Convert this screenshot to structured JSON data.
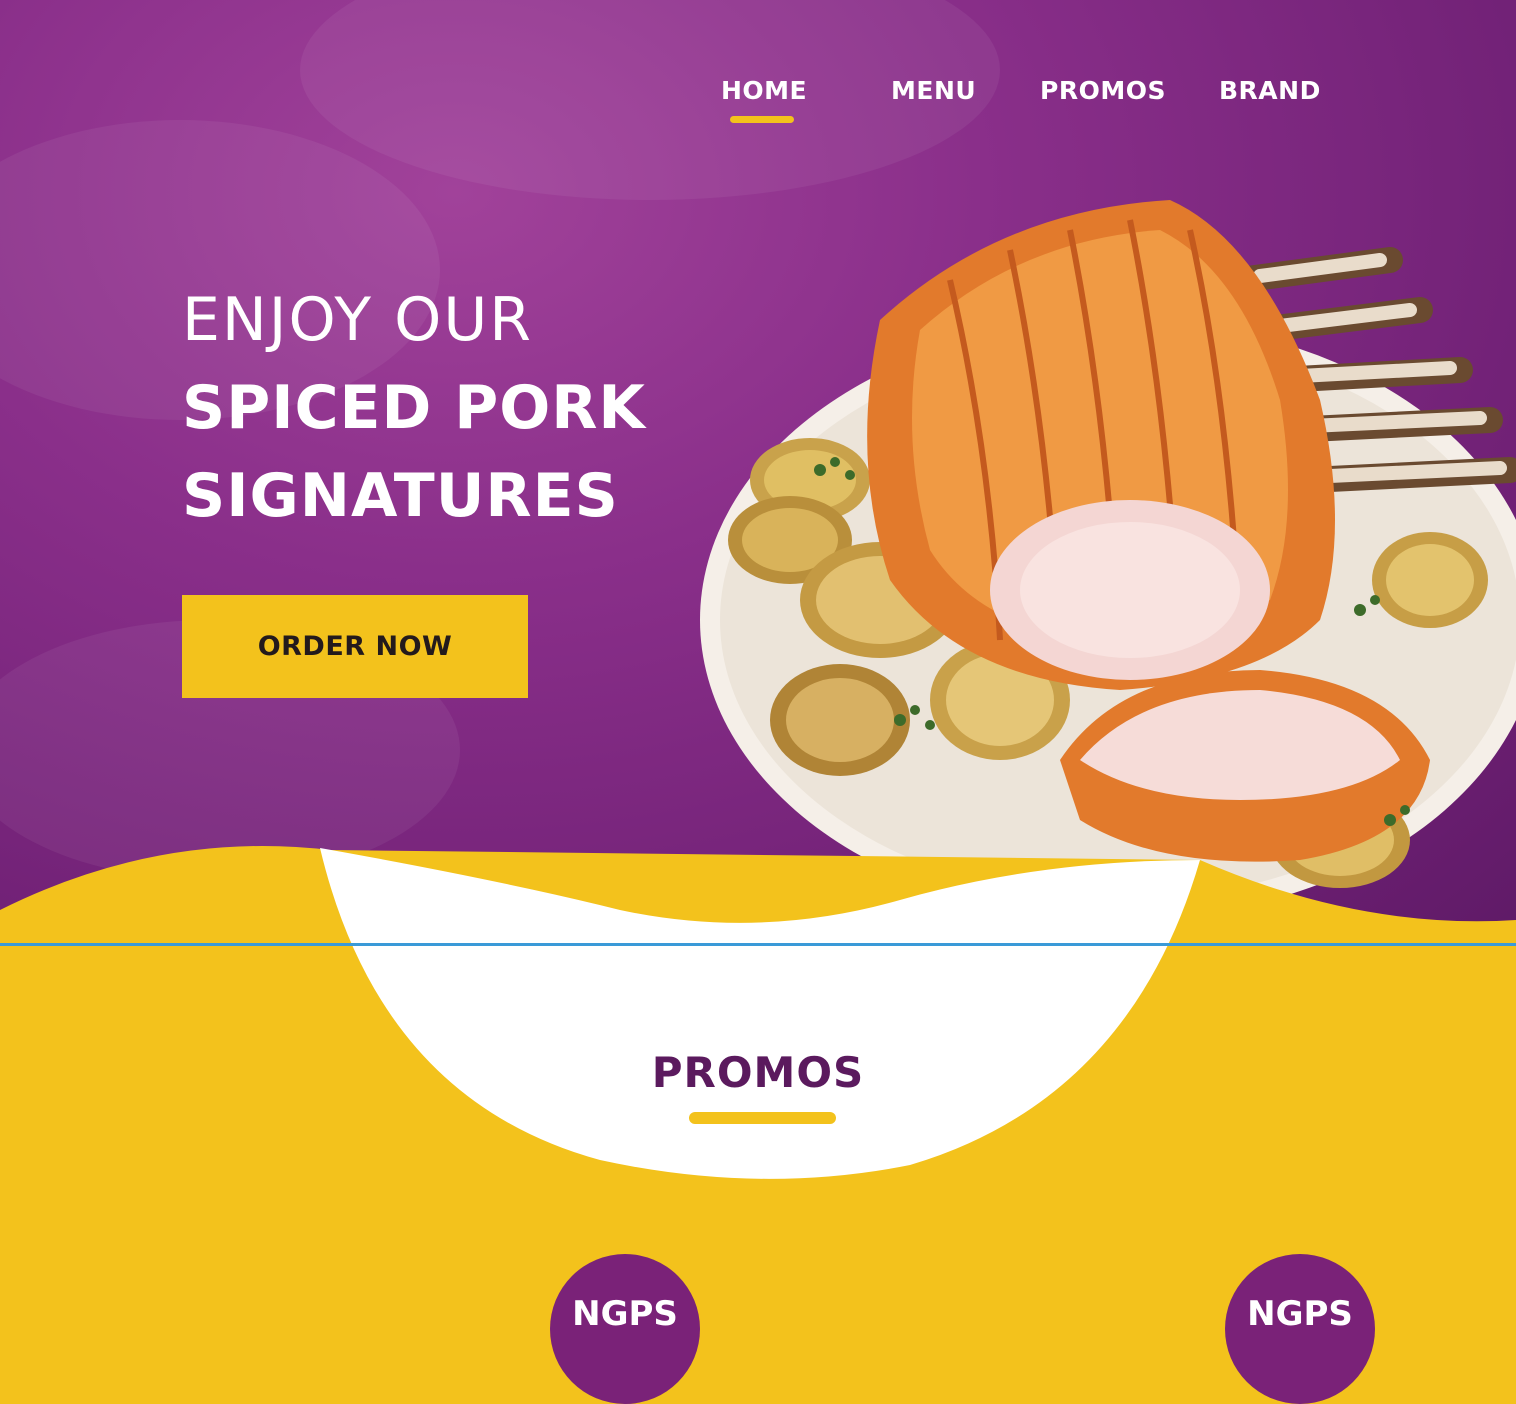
{
  "nav": {
    "items": [
      {
        "label": "HOME",
        "active": true
      },
      {
        "label": "MENU",
        "active": false
      },
      {
        "label": "PROMOS",
        "active": false
      },
      {
        "label": "BRAND",
        "active": false
      }
    ]
  },
  "hero": {
    "line1": "ENJOY OUR",
    "line2": "SPICED PORK",
    "line3": "SIGNATURES",
    "cta": "ORDER NOW",
    "dish_image": "roast-pork-rack-with-apples"
  },
  "promos": {
    "title": "PROMOS",
    "badges": [
      "NGPS",
      "NGPS"
    ]
  },
  "colors": {
    "purple": "#8a2f8a",
    "yellow": "#f3c21c",
    "dark_purple": "#5b1a5e"
  }
}
